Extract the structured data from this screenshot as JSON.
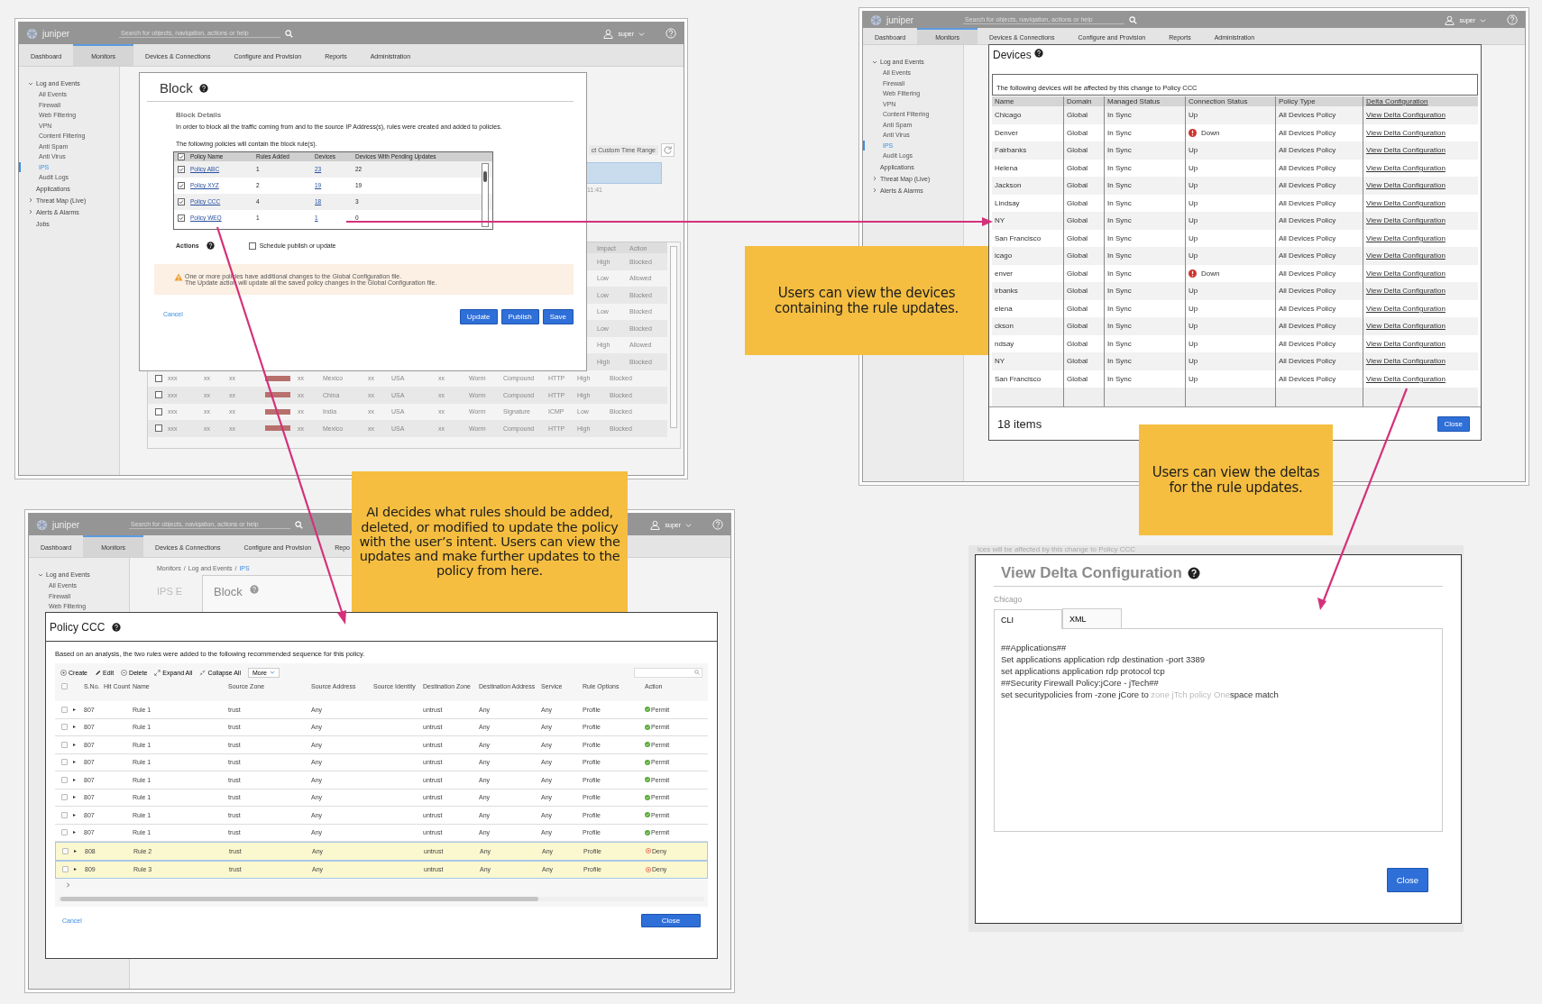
{
  "panels": [
    {
      "kind": "block",
      "app": {
        "logo": "juniper",
        "search_placeholder": "Search for objects, navigation, actions or help",
        "user": "super",
        "tabs": [
          {
            "label": "Dashboard",
            "selected": false
          },
          {
            "label": "Monitors",
            "selected": true
          },
          {
            "label": "Devices & Connections",
            "selected": false
          },
          {
            "label": "Configure and Provision",
            "selected": false
          },
          {
            "label": "Reports",
            "selected": false
          },
          {
            "label": "Administration",
            "selected": false
          }
        ],
        "sidebar": [
          {
            "kind": "group",
            "label": "Log and Events",
            "expanded": true,
            "children": [
              {
                "label": "All Events",
                "selected": false
              },
              {
                "label": "Firewall",
                "selected": false
              },
              {
                "label": "Web Filtering",
                "selected": false
              },
              {
                "label": "VPN",
                "selected": false
              },
              {
                "label": "Content Filtering",
                "selected": false
              },
              {
                "label": "Anti Spam",
                "selected": false
              },
              {
                "label": "Anti Virus",
                "selected": false
              },
              {
                "label": "IPS",
                "selected": true
              },
              {
                "label": "Audit Logs",
                "selected": false
              }
            ]
          },
          {
            "kind": "link",
            "label": "Applications"
          },
          {
            "kind": "group",
            "label": "Threat Map (Live)",
            "expanded": false
          },
          {
            "kind": "group",
            "label": "Alerts & Alarms",
            "expanded": false
          },
          {
            "kind": "link",
            "label": "Jobs"
          }
        ]
      },
      "background": {
        "time_range": "ct Custom Time Range",
        "chart_tick": "11:41",
        "columns": [
          "Impact",
          "Action"
        ],
        "rows": [
          {
            "kind": "partial",
            "cells": [
              "High",
              "Blocked"
            ]
          },
          {
            "kind": "partial",
            "cells": [
              "Low",
              "Allowed"
            ]
          },
          {
            "kind": "partial",
            "cells": [
              "Low",
              "Blocked"
            ]
          },
          {
            "kind": "partial",
            "cells": [
              "Low",
              "Blocked"
            ]
          },
          {
            "kind": "partial",
            "cells": [
              "Low",
              "Blocked"
            ]
          },
          {
            "kind": "partial",
            "cells": [
              "High",
              "Allowed"
            ]
          },
          {
            "kind": "partial",
            "cells": [
              "High",
              "Blocked"
            ]
          },
          {
            "kind": "full",
            "checked": false,
            "cells": [
              "xxx",
              "xx",
              "xx",
              "xx",
              "Mexico",
              "xx",
              "USA",
              "xx",
              "Worm",
              "Compound",
              "HTTP",
              "High",
              "Blocked"
            ]
          },
          {
            "kind": "full",
            "checked": false,
            "cells": [
              "xxx",
              "xx",
              "xx",
              "xx",
              "China",
              "xx",
              "USA",
              "xx",
              "Worm",
              "Compound",
              "HTTP",
              "High",
              "Blocked"
            ]
          },
          {
            "kind": "full",
            "checked": false,
            "cells": [
              "xxx",
              "xx",
              "xx",
              "xx",
              "India",
              "xx",
              "USA",
              "xx",
              "Worm",
              "Signature",
              "ICMP",
              "Low",
              "Blocked"
            ]
          },
          {
            "kind": "full",
            "checked": false,
            "cells": [
              "xxx",
              "xx",
              "xx",
              "xx",
              "Mexico",
              "xx",
              "USA",
              "xx",
              "Worm",
              "Compound",
              "HTTP",
              "High",
              "Blocked"
            ]
          }
        ]
      },
      "modal": {
        "title": "Block",
        "section": "Block Details",
        "description": "In order to block all the traffic coming from and to the source IP Address(s), rules were created and added to policies.",
        "table_caption": "The following policies will contain the block rule(s).",
        "all_checked": true,
        "columns": [
          "Policy Name",
          "Rules Added",
          "Devices",
          "Devices With Pending Updates"
        ],
        "rows": [
          {
            "checked": true,
            "name": "Policy ABC",
            "rules": "1",
            "devices": "23",
            "pending": "22"
          },
          {
            "checked": true,
            "name": "Policy XYZ",
            "rules": "2",
            "devices": "19",
            "pending": "19"
          },
          {
            "checked": true,
            "name": "Policy CCC",
            "rules": "4",
            "devices": "18",
            "pending": "3"
          },
          {
            "checked": true,
            "name": "Policy WEQ",
            "rules": "1",
            "devices": "1",
            "pending": "0"
          }
        ],
        "actions_label": "Actions",
        "schedule": {
          "label": "Schedule publish or update",
          "checked": false
        },
        "warning": [
          "One or more policies have additional changes to the Global Configuration file.",
          "The Update action will update all the saved policy changes in the Global Configuration file."
        ],
        "cancel": "Cancel",
        "buttons": [
          "Update",
          "Publish",
          "Save"
        ]
      }
    },
    {
      "kind": "devices",
      "app": {
        "logo": "juniper",
        "search_placeholder": "Search for objects, navigation, actions or help",
        "user": "super",
        "tabs": [
          {
            "label": "Dashboard",
            "selected": false
          },
          {
            "label": "Monitors",
            "selected": true
          },
          {
            "label": "Devices & Connections",
            "selected": false
          },
          {
            "label": "Configure and Provision",
            "selected": false
          },
          {
            "label": "Reports",
            "selected": false
          },
          {
            "label": "Administration",
            "selected": false
          }
        ],
        "sidebar": [
          {
            "kind": "group",
            "label": "Log and Events",
            "expanded": true,
            "children": [
              {
                "label": "All Events",
                "selected": false
              },
              {
                "label": "Firewall",
                "selected": false
              },
              {
                "label": "Web Filtering",
                "selected": false
              },
              {
                "label": "VPN",
                "selected": false
              },
              {
                "label": "Content Filtering",
                "selected": false
              },
              {
                "label": "Anti Spam",
                "selected": false
              },
              {
                "label": "Anti Virus",
                "selected": false
              },
              {
                "label": "IPS",
                "selected": true
              },
              {
                "label": "Audit Logs",
                "selected": false
              }
            ]
          },
          {
            "kind": "link",
            "label": "Applications"
          },
          {
            "kind": "group",
            "label": "Threat Map (Live)",
            "expanded": false
          },
          {
            "kind": "group",
            "label": "Alerts & Alarms",
            "expanded": false
          }
        ]
      },
      "modal": {
        "title": "Devices",
        "description": "The following devices will be affected by this change to Policy CCC",
        "columns": [
          "Name",
          "Domain",
          "Managed Status",
          "Connection Status",
          "Policy Type",
          "Delta Configuration"
        ],
        "rows": [
          {
            "alert": false,
            "cells": [
              "Chicago",
              "Global",
              "In Sync",
              "Up",
              "All Devices Policy",
              "View Delta Configuration"
            ]
          },
          {
            "alert": true,
            "cells": [
              "Denver",
              "Global",
              "In Sync",
              "Down",
              "All Devices Policy",
              "View Delta Configuration"
            ]
          },
          {
            "alert": false,
            "cells": [
              "Fairbanks",
              "Global",
              "In Sync",
              "Up",
              "All Devices Policy",
              "View Delta Configuration"
            ]
          },
          {
            "alert": false,
            "cells": [
              "Helena",
              "Global",
              "In Sync",
              "Up",
              "All Devices Policy",
              "View Delta Configuration"
            ]
          },
          {
            "alert": false,
            "cells": [
              "Jackson",
              "Global",
              "In Sync",
              "Up",
              "All Devices Policy",
              "View Delta Configuration"
            ]
          },
          {
            "alert": false,
            "cells": [
              "Lindsay",
              "Global",
              "In Sync",
              "Up",
              "All Devices Policy",
              "View Delta Configuration"
            ]
          },
          {
            "alert": false,
            "cells": [
              "NY",
              "Global",
              "In Sync",
              "Up",
              "All Devices Policy",
              "View Delta Configuration"
            ]
          },
          {
            "alert": false,
            "cells": [
              "San Francisco",
              "Global",
              "In Sync",
              "Up",
              "All Devices Policy",
              "View Delta Configuration"
            ]
          },
          {
            "alert": false,
            "cells": [
              "icago",
              "Global",
              "In Sync",
              "Up",
              "All Devices Policy",
              "View Delta Configuration"
            ]
          },
          {
            "alert": true,
            "cells": [
              "enver",
              "Global",
              "In Sync",
              "Down",
              "All Devices Policy",
              "View Delta Configuration"
            ]
          },
          {
            "alert": false,
            "cells": [
              "irbanks",
              "Global",
              "In Sync",
              "Up",
              "All Devices Policy",
              "View Delta Configuration"
            ]
          },
          {
            "alert": false,
            "cells": [
              "elena",
              "Global",
              "In Sync",
              "Up",
              "All Devices Policy",
              "View Delta Configuration"
            ]
          },
          {
            "alert": false,
            "cells": [
              "ckson",
              "Global",
              "In Sync",
              "Up",
              "All Devices Policy",
              "View Delta Configuration"
            ]
          },
          {
            "alert": false,
            "cells": [
              "ndsay",
              "Global",
              "In Sync",
              "Up",
              "All Devices Policy",
              "View Delta Configuration"
            ]
          },
          {
            "alert": false,
            "cells": [
              "NY",
              "Global",
              "In Sync",
              "Up",
              "All Devices Policy",
              "View Delta Configuration"
            ]
          },
          {
            "alert": false,
            "cells": [
              "San Francisco",
              "Global",
              "In Sync",
              "Up",
              "All Devices Policy",
              "View Delta Configuration"
            ]
          }
        ],
        "count": "18 items",
        "close": "Close"
      }
    },
    {
      "kind": "policy",
      "app": {
        "logo": "juniper",
        "search_placeholder": "Search for objects, navigation, actions or help",
        "user": "super",
        "tabs": [
          {
            "label": "Dashboard",
            "selected": false
          },
          {
            "label": "Monitors",
            "selected": true
          },
          {
            "label": "Devices & Connections",
            "selected": false
          },
          {
            "label": "Configure and Provision",
            "selected": false
          },
          {
            "label": "Repo",
            "selected": false
          }
        ],
        "sidebar": [
          {
            "kind": "group",
            "label": "Log and Events",
            "expanded": true,
            "children": [
              {
                "label": "All Events",
                "selected": false
              },
              {
                "label": "Firewall",
                "selected": false
              },
              {
                "label": "Web Filtering",
                "selected": false
              }
            ]
          }
        ]
      },
      "background": {
        "separator": "/",
        "breadcrumb": [
          {
            "label": "Monitors",
            "selected": false
          },
          {
            "label": "Log and Events",
            "selected": false
          },
          {
            "label": "IPS",
            "selected": true
          }
        ],
        "page_title": "IPS E",
        "dialog_title": "Block"
      },
      "modal": {
        "title": "Policy CCC",
        "description": "Based on an analysis, the two rules were added to the following recommended sequence for this policy.",
        "toolbar": [
          {
            "kind": "create",
            "label": "Create"
          },
          {
            "kind": "edit",
            "label": "Edit"
          },
          {
            "kind": "delete",
            "label": "Delete"
          },
          {
            "kind": "expand",
            "label": "Expand All"
          },
          {
            "kind": "collapse",
            "label": "Collapse All"
          }
        ],
        "more": "More",
        "all_checked": false,
        "columns": [
          "S.No.",
          "Hit Count",
          "Name",
          "Source Zone",
          "Source Address",
          "Source Identity",
          "Destination Zone",
          "Destination Address",
          "Service",
          "Rule Options",
          "Action"
        ],
        "rows": [
          {
            "added": false,
            "kind": "permit",
            "sno": "807",
            "name": "Rule 1",
            "source_zone": "trust",
            "source_address": "Any",
            "destination_zone": "untrust",
            "destination_address": "Any",
            "service": "Any",
            "rule_options": "Profile",
            "action": "Permit"
          },
          {
            "added": false,
            "kind": "permit",
            "sno": "807",
            "name": "Rule 1",
            "source_zone": "trust",
            "source_address": "Any",
            "destination_zone": "untrust",
            "destination_address": "Any",
            "service": "Any",
            "rule_options": "Profile",
            "action": "Permit"
          },
          {
            "added": false,
            "kind": "permit",
            "sno": "807",
            "name": "Rule 1",
            "source_zone": "trust",
            "source_address": "Any",
            "destination_zone": "untrust",
            "destination_address": "Any",
            "service": "Any",
            "rule_options": "Profile",
            "action": "Permit"
          },
          {
            "added": false,
            "kind": "permit",
            "sno": "807",
            "name": "Rule 1",
            "source_zone": "trust",
            "source_address": "Any",
            "destination_zone": "untrust",
            "destination_address": "Any",
            "service": "Any",
            "rule_options": "Profile",
            "action": "Permit"
          },
          {
            "added": false,
            "kind": "permit",
            "sno": "807",
            "name": "Rule 1",
            "source_zone": "trust",
            "source_address": "Any",
            "destination_zone": "untrust",
            "destination_address": "Any",
            "service": "Any",
            "rule_options": "Profile",
            "action": "Permit"
          },
          {
            "added": false,
            "kind": "permit",
            "sno": "807",
            "name": "Rule 1",
            "source_zone": "trust",
            "source_address": "Any",
            "destination_zone": "untrust",
            "destination_address": "Any",
            "service": "Any",
            "rule_options": "Profile",
            "action": "Permit"
          },
          {
            "added": false,
            "kind": "permit",
            "sno": "807",
            "name": "Rule 1",
            "source_zone": "trust",
            "source_address": "Any",
            "destination_zone": "untrust",
            "destination_address": "Any",
            "service": "Any",
            "rule_options": "Profile",
            "action": "Permit"
          },
          {
            "added": false,
            "kind": "permit",
            "sno": "807",
            "name": "Rule 1",
            "source_zone": "trust",
            "source_address": "Any",
            "destination_zone": "untrust",
            "destination_address": "Any",
            "service": "Any",
            "rule_options": "Profile",
            "action": "Permit"
          },
          {
            "added": true,
            "kind": "deny",
            "sno": "808",
            "name": "Rule 2",
            "source_zone": "trust",
            "source_address": "Any",
            "destination_zone": "untrust",
            "destination_address": "Any",
            "service": "Any",
            "rule_options": "Profile",
            "action": "Deny"
          },
          {
            "added": true,
            "kind": "deny",
            "sno": "809",
            "name": "Rule 3",
            "source_zone": "trust",
            "source_address": "Any",
            "destination_zone": "untrust",
            "destination_address": "Any",
            "service": "Any",
            "rule_options": "Profile",
            "action": "Deny"
          }
        ],
        "cancel": "Cancel",
        "close": "Close"
      }
    },
    {
      "kind": "delta",
      "background": {
        "caption": "ices will be affected by this change to Policy CCC"
      },
      "modal": {
        "title": "View Delta Configuration",
        "device": "Chicago",
        "tabs": [
          {
            "label": "CLI",
            "selected": true
          },
          {
            "label": "XML",
            "selected": false
          }
        ],
        "lines": [
          [
            {
              "text": "##Applications##",
              "faded": false
            }
          ],
          [
            {
              "text": "Set applications application rdp destination -port 3389",
              "faded": false
            }
          ],
          [
            {
              "text": "set applications application rdp protocol tcp",
              "faded": false
            }
          ],
          [
            {
              "text": "##Security Firewall Policy:jCore - jTech##",
              "faded": false
            }
          ],
          [
            {
              "text": "set securitypolicies from -zone jCore to ",
              "faded": false
            },
            {
              "text": "zone jTch policy One",
              "faded": true
            },
            {
              "text": "space match",
              "faded": false
            }
          ]
        ],
        "close": "Close"
      }
    }
  ],
  "callouts": [
    {
      "kind": "devices",
      "text": "Users can view the devices containing the rule updates."
    },
    {
      "kind": "deltas",
      "text": "Users can view the deltas for the rule updates."
    },
    {
      "kind": "policy",
      "text": "AI decides what rules should be added, deleted, or modified to update the policy with the user’s intent. Users can view the updates and make further updates to the policy from here."
    }
  ]
}
